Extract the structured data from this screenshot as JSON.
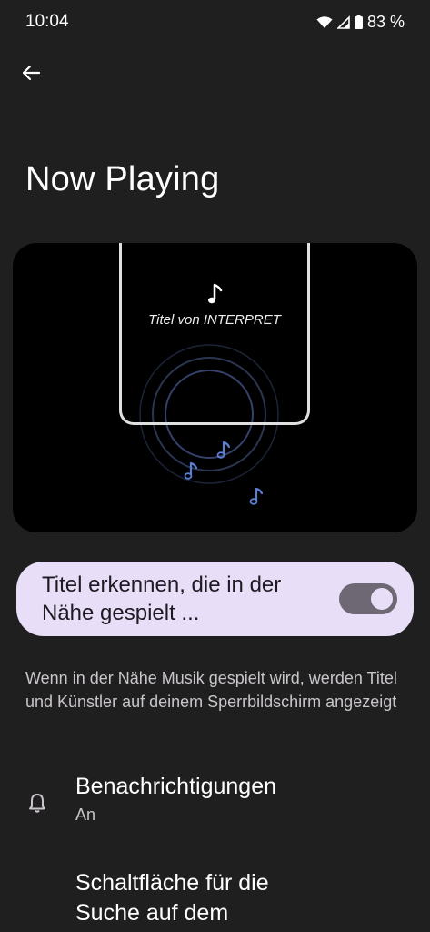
{
  "status_bar": {
    "time": "10:04",
    "battery": "83 %"
  },
  "header": {
    "title": "Now Playing"
  },
  "illustration": {
    "track_text": "Titel von INTERPRET"
  },
  "toggle": {
    "label": "Titel erkennen, die in der Nähe gespielt ...",
    "checked": true
  },
  "description": "Wenn in der Nähe Musik gespielt wird, werden Titel und Künstler auf deinem Sperrbildschirm angezeigt",
  "preferences": [
    {
      "icon": "bell-icon",
      "title": "Benachrichtigungen",
      "summary": "An"
    },
    {
      "title": "Schaltfläche für die Suche auf dem"
    }
  ],
  "colors": {
    "background": "#1f1f1f",
    "toggle_card": "#e8def8",
    "accent_note": "#5b7fd6"
  }
}
